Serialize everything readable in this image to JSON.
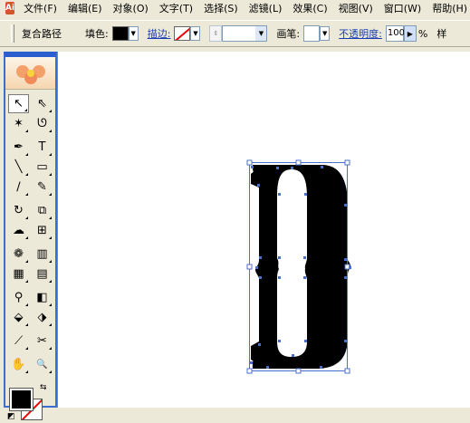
{
  "app": {
    "logo_text": "Ai"
  },
  "menu": [
    "文件(F)",
    "编辑(E)",
    "对象(O)",
    "文字(T)",
    "选择(S)",
    "滤镜(L)",
    "效果(C)",
    "视图(V)",
    "窗口(W)",
    "帮助(H)"
  ],
  "control_bar": {
    "selection_type": "复合路径",
    "fill_label": "填色:",
    "fill_color": "#000000",
    "stroke_label": "描边:",
    "stroke_value": "",
    "brush_label": "画笔:",
    "opacity_label": "不透明度:",
    "opacity_value": "100",
    "opacity_unit": "%",
    "style_label": "样"
  },
  "toolbox": {
    "tools": [
      [
        "selection-tool",
        "direct-selection-tool"
      ],
      [
        "magic-wand-tool",
        "lasso-tool"
      ],
      [
        "pen-tool",
        "type-tool"
      ],
      [
        "line-segment-tool",
        "rectangle-tool"
      ],
      [
        "paintbrush-tool",
        "pencil-tool"
      ],
      [
        "rotate-tool",
        "scale-tool"
      ],
      [
        "warp-tool",
        "free-transform-tool"
      ],
      [
        "symbol-sprayer-tool",
        "column-graph-tool"
      ],
      [
        "mesh-tool",
        "gradient-tool"
      ],
      [
        "eyedropper-tool",
        "blend-tool"
      ],
      [
        "live-paint-bucket-tool",
        "live-paint-selection-tool"
      ],
      [
        "slice-tool",
        "scissors-tool"
      ],
      [
        "hand-tool",
        "zoom-tool"
      ]
    ],
    "tool_glyphs": {
      "selection-tool": "↖",
      "direct-selection-tool": "⇖",
      "magic-wand-tool": "✶",
      "lasso-tool": "ᘎ",
      "pen-tool": "✒",
      "type-tool": "T",
      "line-segment-tool": "╲",
      "rectangle-tool": "▭",
      "paintbrush-tool": "∕",
      "pencil-tool": "✎",
      "rotate-tool": "↻",
      "scale-tool": "⧉",
      "warp-tool": "☁",
      "free-transform-tool": "⊞",
      "symbol-sprayer-tool": "❁",
      "column-graph-tool": "▥",
      "mesh-tool": "▦",
      "gradient-tool": "▤",
      "eyedropper-tool": "⚲",
      "blend-tool": "◧",
      "live-paint-bucket-tool": "⬙",
      "live-paint-selection-tool": "⬗",
      "slice-tool": "⟋",
      "scissors-tool": "✂",
      "hand-tool": "✋",
      "zoom-tool": "🔍"
    },
    "active_tool": "selection-tool"
  },
  "colors": {
    "fill": "#000000",
    "stroke": "none",
    "selection": "#4a6fcf",
    "accent_bar": "#2b5fcf"
  }
}
